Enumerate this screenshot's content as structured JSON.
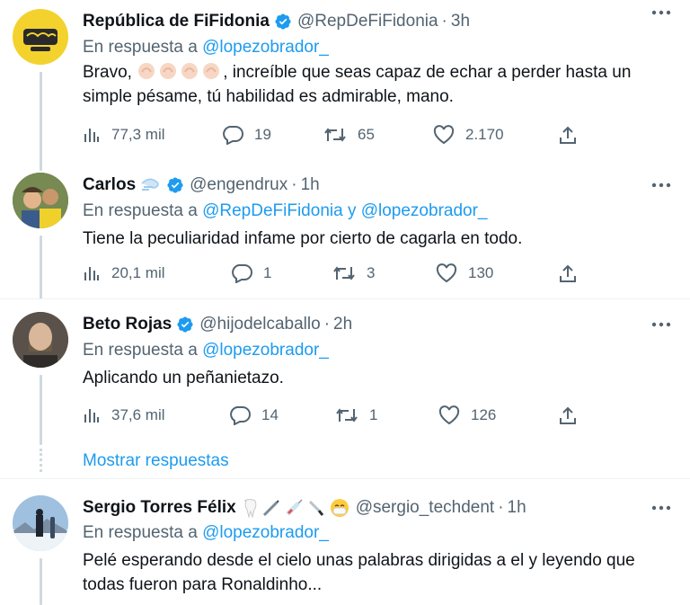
{
  "tweets": [
    {
      "name": "República de FiFidonia",
      "handle": "@RepDeFiFidonia",
      "time": "3h",
      "reply_prefix": "En respuesta a",
      "reply_users": "@lopezobrador_",
      "text_before": "Bravo, ",
      "text_after": ", increíble que seas capaz de echar a perder hasta un simple pésame, tú habilidad es admirable, mano.",
      "views": "77,3 mil",
      "replies": "19",
      "retweets": "65",
      "likes": "2.170",
      "avatar_icon": "rat-logo-avatar",
      "verified": true
    },
    {
      "name": "Carlos",
      "handle": "@engendrux",
      "time": "1h",
      "reply_prefix": "En respuesta a",
      "reply_users": "@RepDeFiFidonia y @lopezobrador_",
      "text": "Tiene la peculiaridad infame por cierto de cagarla en todo.",
      "views": "20,1 mil",
      "replies": "1",
      "retweets": "3",
      "likes": "130",
      "name_emoji": "dash-emoji",
      "verified": true
    },
    {
      "name": "Beto Rojas",
      "handle": "@hijodelcaballo",
      "time": "2h",
      "reply_prefix": "En respuesta a",
      "reply_users": "@lopezobrador_",
      "text": "Aplicando un peñanietazo.",
      "views": "37,6 mil",
      "replies": "14",
      "retweets": "1",
      "likes": "126",
      "verified": true
    },
    {
      "name": "Sergio Torres Félix",
      "handle": "@sergio_techdent",
      "time": "1h",
      "reply_prefix": "En respuesta a",
      "reply_users": "@lopezobrador_",
      "text": "Pelé esperando desde el cielo unas palabras dirigidas a el y leyendo que todas fueron para Ronaldinho...",
      "name_emojis": [
        "tooth-emoji",
        "dental-tool-emoji",
        "syringe-emoji",
        "scalpel-emoji",
        "mask-face-emoji"
      ]
    }
  ],
  "show_replies": "Mostrar respuestas",
  "dot": "·",
  "colors": {
    "link": "#1d9bf0",
    "muted": "#536471",
    "verified": "#1d9bf0"
  }
}
